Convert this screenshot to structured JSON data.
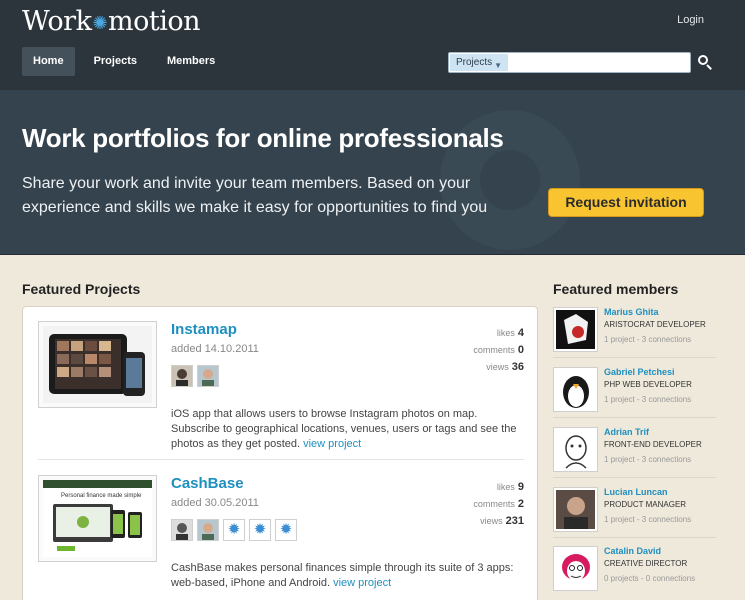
{
  "app": {
    "logo_text_left": "Work",
    "logo_text_right": "motion",
    "login_label": "Login"
  },
  "nav": {
    "items": [
      {
        "label": "Home",
        "active": true
      },
      {
        "label": "Projects",
        "active": false
      },
      {
        "label": "Members",
        "active": false
      }
    ]
  },
  "search": {
    "scope_label": "Projects",
    "value": "",
    "placeholder": ""
  },
  "hero": {
    "title": "Work portfolios for online professionals",
    "subtitle": "Share your work and invite your team members. Based on your experience and skills we make it easy for opportunities to find you",
    "cta_label": "Request invitation"
  },
  "featured_projects": {
    "title": "Featured Projects",
    "projects": [
      {
        "name": "Instamap",
        "date": "added 14.10.2011",
        "stats": [
          {
            "label": "likes",
            "value": "4"
          },
          {
            "label": "comments",
            "value": "0"
          },
          {
            "label": "views",
            "value": "36"
          }
        ],
        "description": "iOS app that allows users to browse Instagram photos on map. Subscribe to geographical locations, venues, users or tags and see the photos as they get posted.",
        "link_label": "view project"
      },
      {
        "name": "CashBase",
        "date": "added 30.05.2011",
        "stats": [
          {
            "label": "likes",
            "value": "9"
          },
          {
            "label": "comments",
            "value": "2"
          },
          {
            "label": "views",
            "value": "231"
          }
        ],
        "description": "CashBase makes personal finances simple through its suite of 3 apps: web-based, iPhone and Android.",
        "link_label": "view project",
        "thumb_title": "Personal finance made simple"
      }
    ]
  },
  "featured_members": {
    "title": "Featured members",
    "members": [
      {
        "name": "Marius Ghita",
        "role": "ARISTOCRAT DEVELOPER",
        "connections": "1 project - 3 connections"
      },
      {
        "name": "Gabriel Petchesi",
        "role": "PHP WEB DEVELOPER",
        "connections": "1 project - 3 connections"
      },
      {
        "name": "Adrian Trif",
        "role": "FRONT-END DEVELOPER",
        "connections": "1 project - 3 connections"
      },
      {
        "name": "Lucian Luncan",
        "role": "PRODUCT MANAGER",
        "connections": "1 project - 3 connections"
      },
      {
        "name": "Catalin David",
        "role": "CREATIVE DIRECTOR",
        "connections": "0 projects - 0 connections"
      }
    ]
  },
  "colors": {
    "accent": "#1f8fbf",
    "cta": "#f8c430",
    "header_bg": "#2c353c",
    "hero_bg": "#34434d"
  }
}
